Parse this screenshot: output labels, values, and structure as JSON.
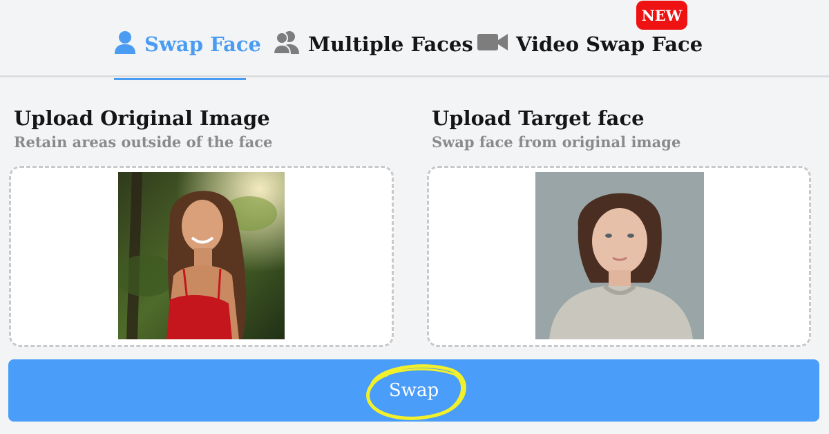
{
  "tabs": [
    {
      "label": "Swap Face",
      "icon": "user-icon",
      "active": true
    },
    {
      "label": "Multiple Faces",
      "icon": "users-icon",
      "active": false
    },
    {
      "label": "Video Swap Face",
      "icon": "video-camera-icon",
      "active": false
    }
  ],
  "badge": {
    "label": "NEW"
  },
  "original": {
    "title": "Upload Original Image",
    "subtitle": "Retain areas outside of the face"
  },
  "target": {
    "title": "Upload Target face",
    "subtitle": "Swap face from original image"
  },
  "swap_button": {
    "label": "Swap"
  },
  "colors": {
    "accent": "#4a9cf2",
    "button": "#4a9df8",
    "badge": "#ef1212",
    "highlight_circle": "#f2f02a"
  }
}
